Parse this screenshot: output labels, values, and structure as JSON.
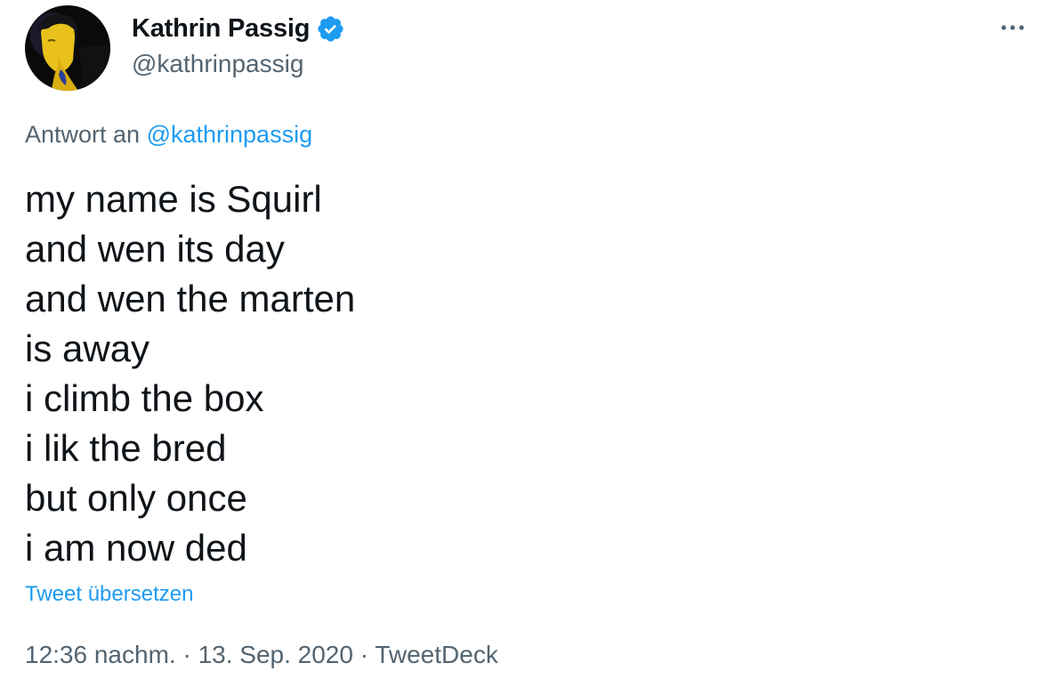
{
  "author": {
    "display_name": "Kathrin Passig",
    "handle": "@kathrinpassig",
    "verified": true
  },
  "reply": {
    "prefix": "Antwort an",
    "mention": "@kathrinpassig"
  },
  "tweet": {
    "lines": [
      "my name is Squirl",
      "and wen its day",
      "and wen the marten",
      "is away",
      "i climb the box",
      "i lik the bred",
      "but only once",
      "i am now ded"
    ],
    "translate_label": "Tweet übersetzen"
  },
  "meta": {
    "time": "12:36 nachm.",
    "separator": "·",
    "date": "13. Sep. 2020",
    "source": "TweetDeck"
  },
  "icons": {
    "more": "more-horizontal-icon",
    "verified": "verified-badge-icon"
  },
  "colors": {
    "link": "#1d9bf0",
    "secondary_text": "#536471",
    "primary_text": "#0f1419"
  }
}
